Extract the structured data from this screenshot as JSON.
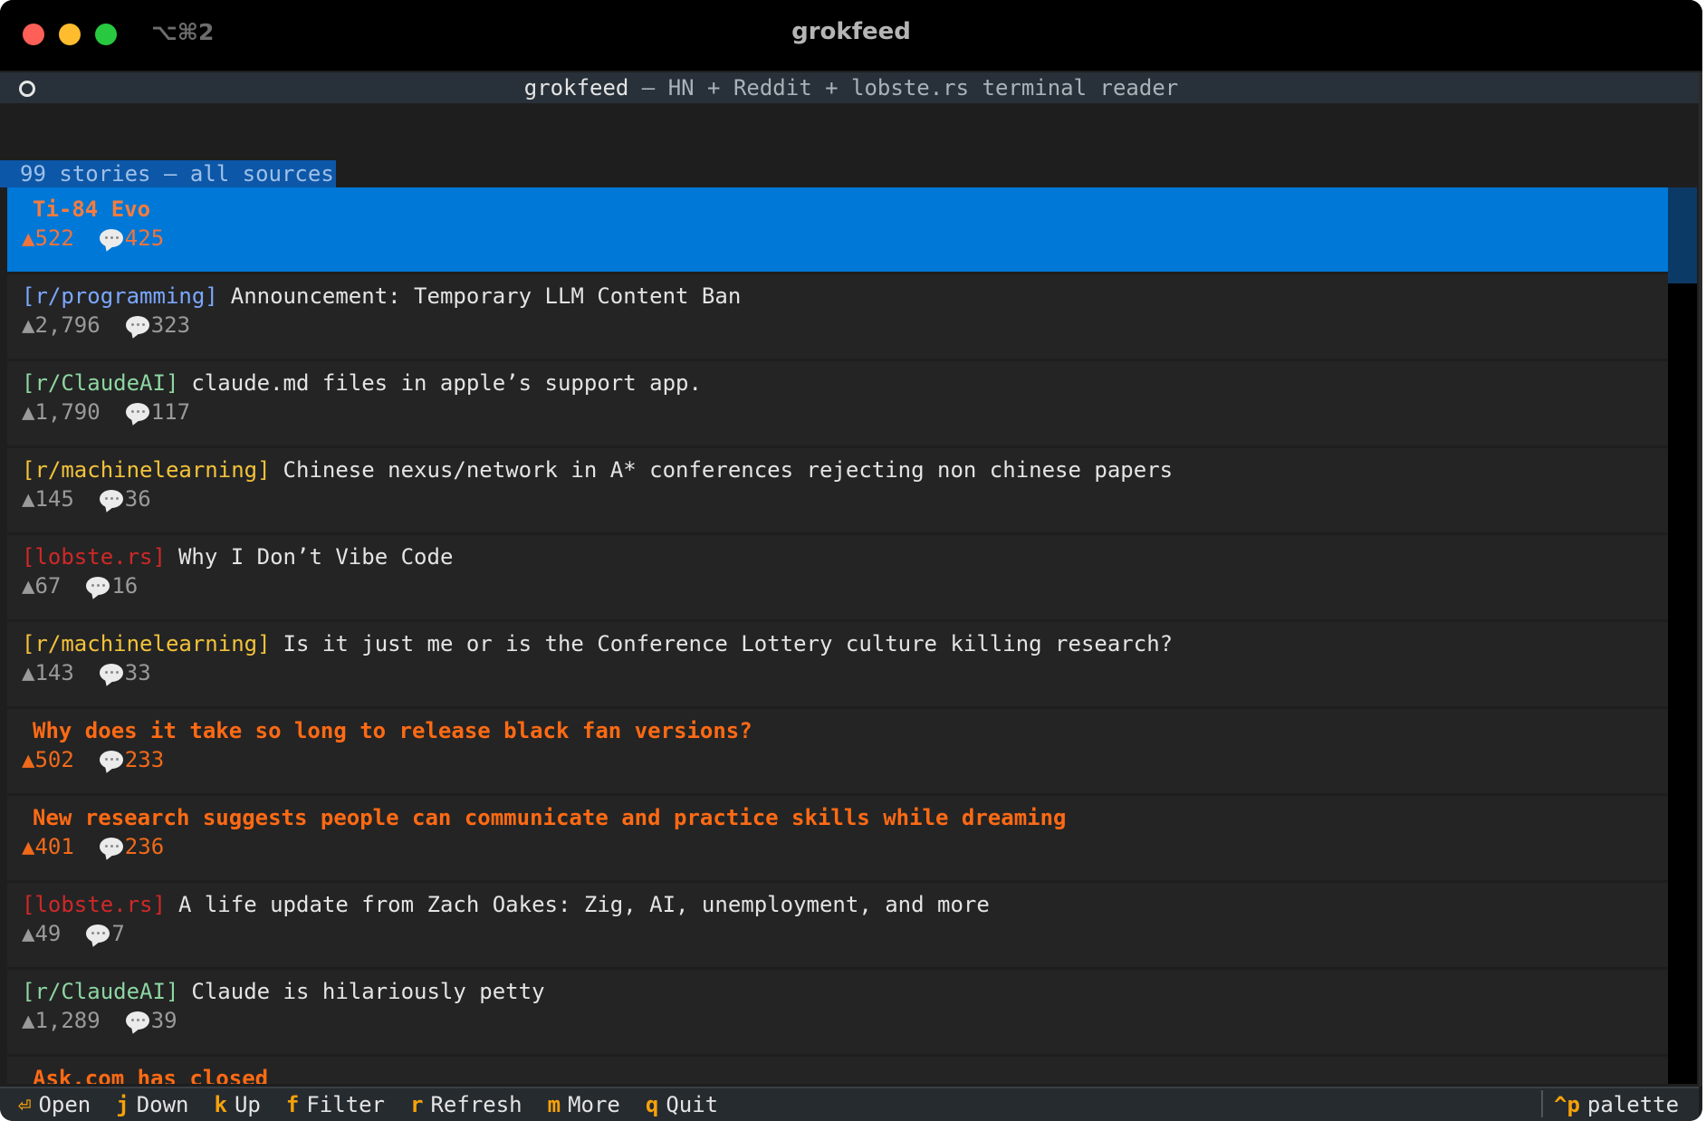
{
  "window": {
    "title": "grokfeed",
    "shortcut": "⌥⌘2"
  },
  "header": {
    "app": "grokfeed",
    "subtitle": " — HN + Reddit + lobste.rs terminal reader"
  },
  "list": {
    "count_label": "99 stories — all sources"
  },
  "stories": [
    {
      "source": "",
      "title": "Ti-84 Evo",
      "score": "▲522",
      "comments": "425",
      "kind": "hn",
      "selected": true
    },
    {
      "source": "[r/programming]",
      "title": "Announcement: Temporary LLM Content Ban",
      "score": "▲2,796",
      "comments": "323",
      "kind": "programming"
    },
    {
      "source": "[r/ClaudeAI]",
      "title": "claude.md files in apple’s support app.",
      "score": "▲1,790",
      "comments": "117",
      "kind": "claude"
    },
    {
      "source": "[r/machinelearning]",
      "title": "Chinese nexus/network in A* conferences rejecting non chinese papers",
      "score": "▲145",
      "comments": "36",
      "kind": "ml"
    },
    {
      "source": "[lobste.rs]",
      "title": "Why I Don’t Vibe Code",
      "score": "▲67",
      "comments": "16",
      "kind": "lobste"
    },
    {
      "source": "[r/machinelearning]",
      "title": "Is it just me or is the Conference Lottery culture killing research?",
      "score": "▲143",
      "comments": "33",
      "kind": "ml"
    },
    {
      "source": "",
      "title": "Why does it take so long to release black fan versions?",
      "score": "▲502",
      "comments": "233",
      "kind": "hn"
    },
    {
      "source": "",
      "title": "New research suggests people can communicate and practice skills while dreaming",
      "score": "▲401",
      "comments": "236",
      "kind": "hn"
    },
    {
      "source": "[lobste.rs]",
      "title": "A life update from Zach Oakes: Zig, AI, unemployment, and more",
      "score": "▲49",
      "comments": "7",
      "kind": "lobste"
    },
    {
      "source": "[r/ClaudeAI]",
      "title": "Claude is hilariously petty",
      "score": "▲1,289",
      "comments": "39",
      "kind": "claude"
    },
    {
      "source": "",
      "title": "Ask.com has closed",
      "score": "",
      "comments": "",
      "kind": "hn"
    }
  ],
  "footer": {
    "bindings": [
      {
        "key": "⏎",
        "label": "Open"
      },
      {
        "key": "j",
        "label": "Down"
      },
      {
        "key": "k",
        "label": "Up"
      },
      {
        "key": "f",
        "label": "Filter"
      },
      {
        "key": "r",
        "label": "Refresh"
      },
      {
        "key": "m",
        "label": "More"
      },
      {
        "key": "q",
        "label": "Quit"
      }
    ],
    "palette_key": "^p",
    "palette_label": "palette"
  },
  "colors": {
    "selection": "#0078d7",
    "hn_orange": "#ff6a14",
    "key_accent": "#f5a20a"
  },
  "icons": [
    "close-icon",
    "minimize-icon",
    "zoom-icon",
    "circle-icon",
    "comment-bubble-icon"
  ]
}
